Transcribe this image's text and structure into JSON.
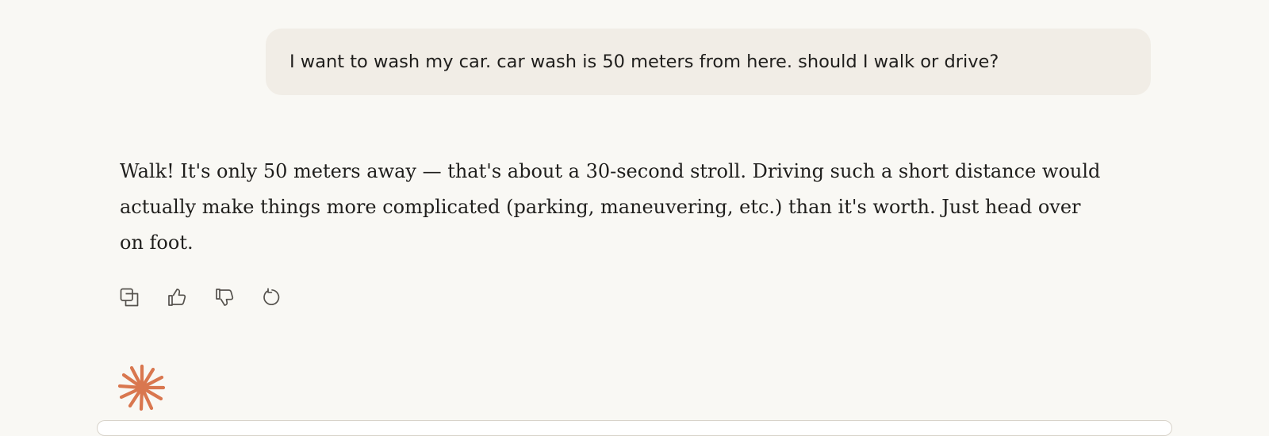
{
  "conversation": {
    "user_message": "I want to wash my car. car wash is 50 meters from here. should I walk or drive?",
    "assistant_response": "Walk! It's only 50 meters away — that's about a 30-second stroll. Driving such a short distance would actually make things more complicated (parking, maneuvering, etc.) than it's worth. Just head over on foot."
  },
  "actions": [
    {
      "icon": "copy-icon"
    },
    {
      "icon": "thumbs-up-icon"
    },
    {
      "icon": "thumbs-down-icon"
    },
    {
      "icon": "retry-icon"
    }
  ],
  "theme": {
    "background": "#f9f8f4",
    "user_bubble": "#f1ede6",
    "text": "#1f1e1c",
    "icon": "#55524d",
    "accent": "#d9774f"
  },
  "branding": {
    "logo_icon": "sparkle-logo-icon"
  }
}
